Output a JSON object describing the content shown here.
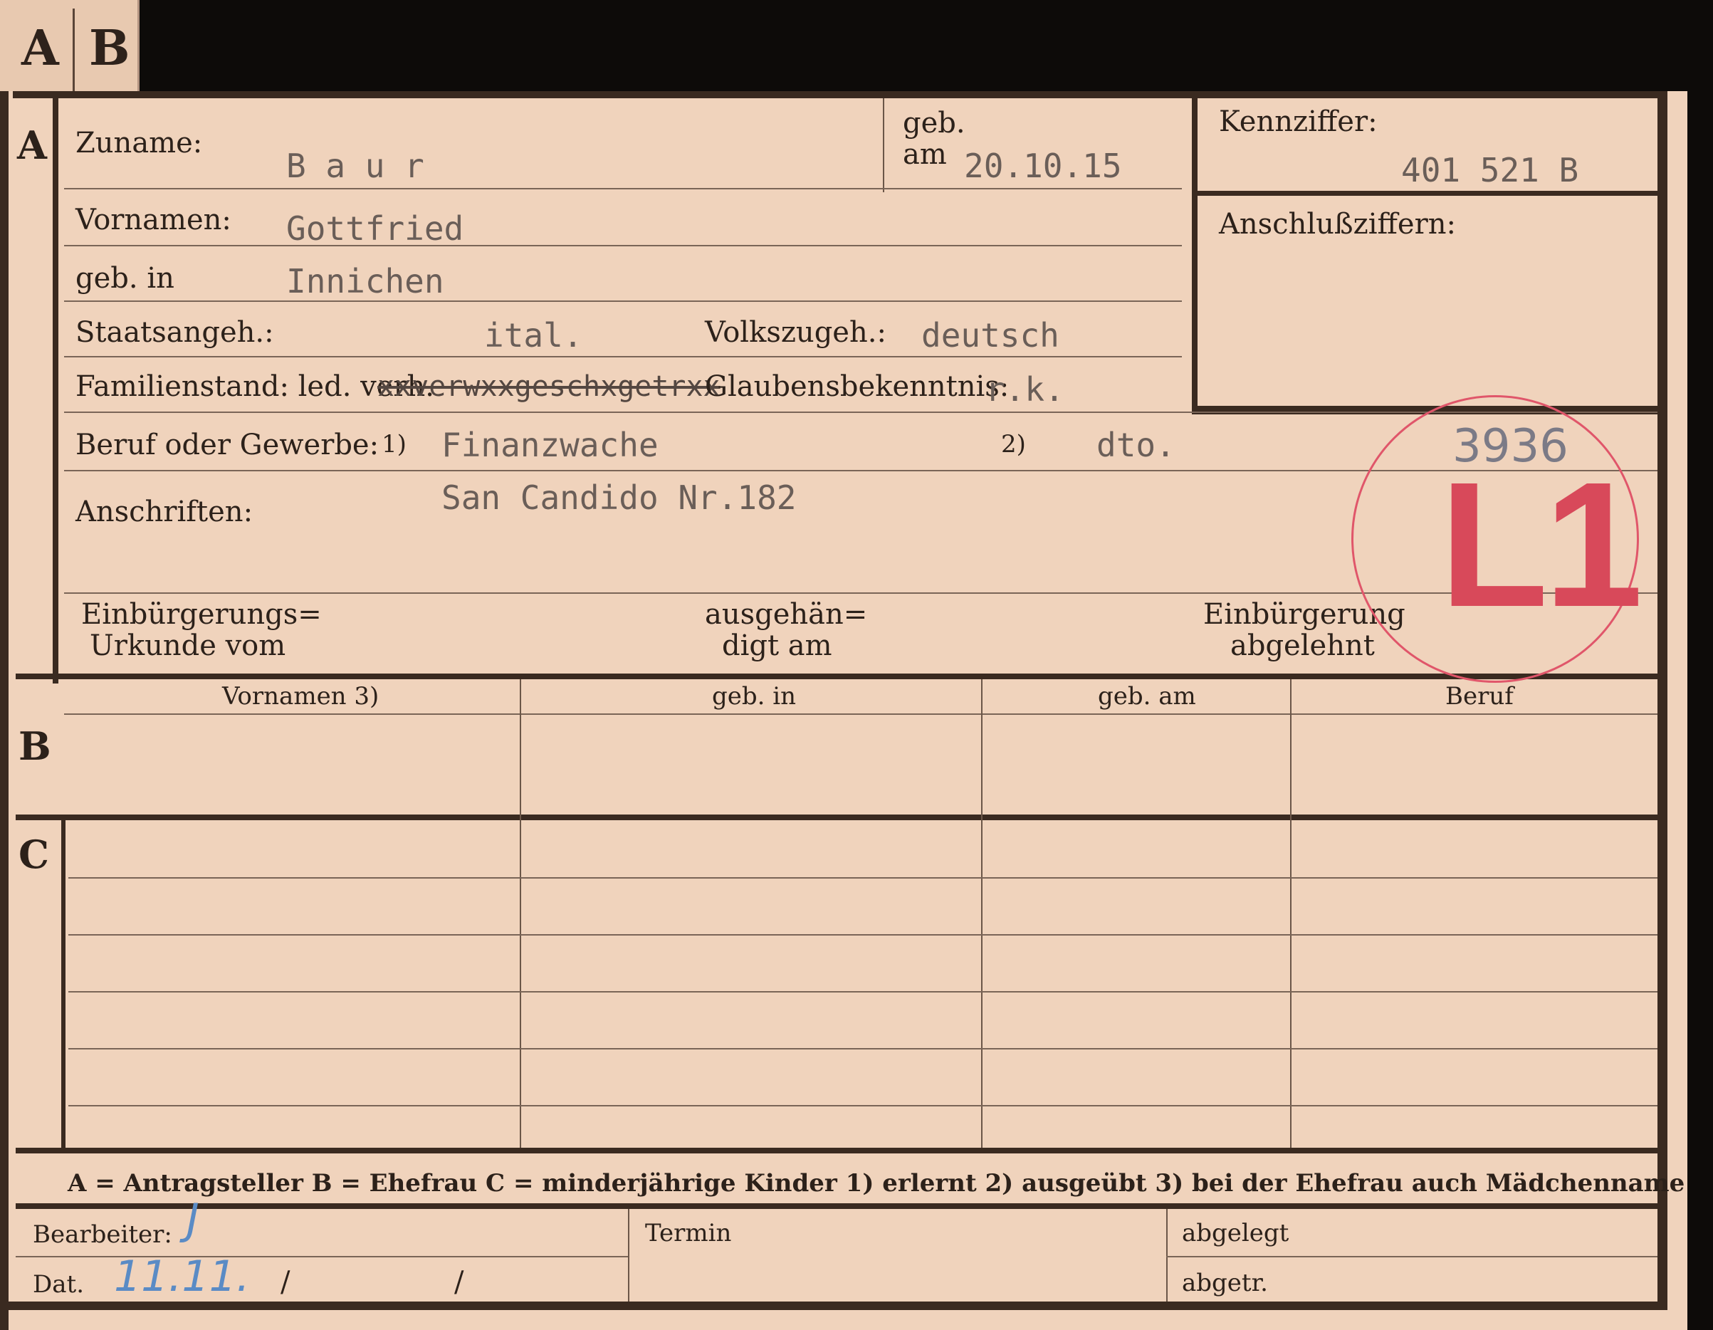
{
  "tab": {
    "a": "A",
    "b": "B"
  },
  "sections": {
    "a": "A",
    "b": "B",
    "c": "C"
  },
  "labels": {
    "zuname": "Zuname:",
    "geb_am_top": "geb.",
    "geb_am_bottom": "am",
    "kennziffer": "Kennziffer:",
    "anschlussziffern": "Anschlußziffern:",
    "vornamen": "Vornamen:",
    "geb_in": "geb. in",
    "staatsangeh": "Staatsangeh.:",
    "volkszugeh": "Volkszugeh.:",
    "familienstand": "Familienstand: led. verh.",
    "glaubensbekenntnis": "Glaubensbekenntnis:",
    "beruf": "Beruf oder Gewerbe:",
    "beruf_fn1": "1)",
    "beruf_fn2": "2)",
    "anschriften": "Anschriften:",
    "einbuergerungs_1": "Einbürgerungs=",
    "einbuergerungs_2": "Urkunde vom",
    "ausgehaen_1": "ausgehän=",
    "ausgehaen_2": "digt am",
    "abgelehnt_1": "Einbürgerung",
    "abgelehnt_2": "abgelehnt"
  },
  "values": {
    "zuname": "B a u r",
    "geb_am": "20.10.15",
    "kennziffer": "401 521 B",
    "vornamen": "Gottfried",
    "geb_in": "Innichen",
    "staatsangeh": "ital.",
    "volkszugeh": "deutsch",
    "familienstand_strike": "xxverwxxgeschxgetrxx",
    "glaubensbekenntnis": "r.k.",
    "beruf_1": "Finanzwache",
    "beruf_2": "dto.",
    "anschriften": "San Candido Nr.182"
  },
  "table": {
    "headers": [
      "Vornamen 3)",
      "geb. in",
      "geb. am",
      "Beruf"
    ]
  },
  "footer": "A = Antragsteller   B = Ehefrau   C = minderjährige Kinder   1) erlernt   2) ausgeübt   3) bei der Ehefrau auch Mädchenname",
  "office": {
    "bearbeiter": "Bearbeiter:",
    "termin": "Termin",
    "abgelegt": "abgelegt",
    "dat": "Dat.",
    "abgetr": "abgetr.",
    "dat_sep1": "/",
    "dat_sep2": "/"
  },
  "handwriting": {
    "pencil_number": "3936",
    "stamp": "L1",
    "bearbeiter_mark": "J",
    "date": "11.11."
  },
  "colors": {
    "paper": "#f0d3bc",
    "stamp": "#d8495a",
    "ink_blue": "#5a8bc5"
  }
}
